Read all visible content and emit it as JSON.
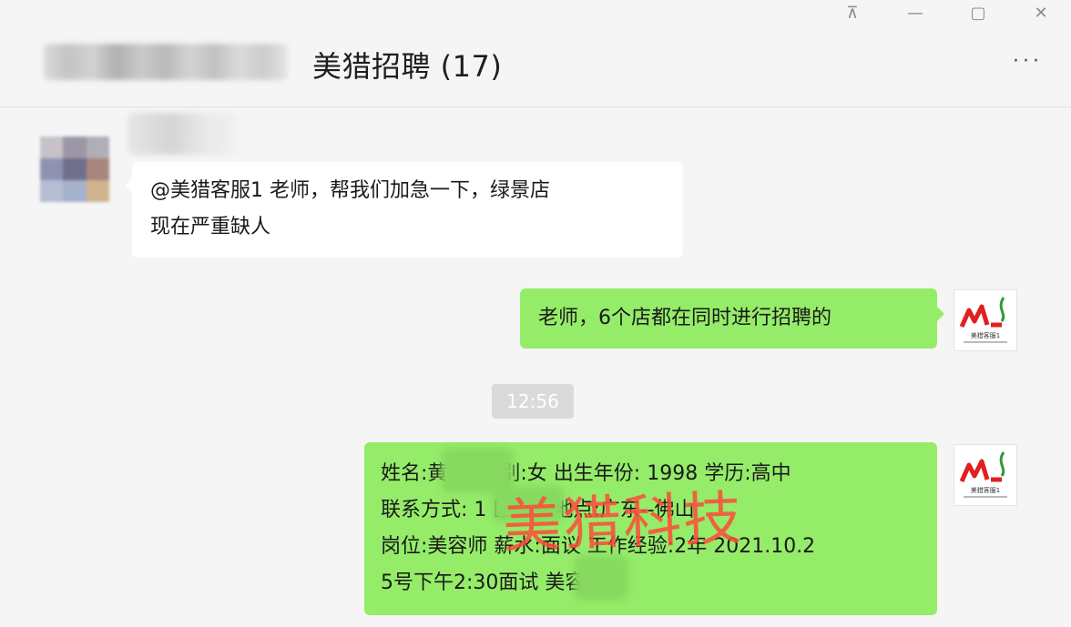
{
  "window": {
    "pin_glyph": "⊼",
    "minimize_glyph": "—",
    "maximize_glyph": "▢",
    "close_glyph": "✕"
  },
  "header": {
    "title": "美猎招聘 (17)",
    "more_glyph": "···"
  },
  "messages": [
    {
      "side": "left",
      "lines": [
        "@美猎客服1 老师，帮我们加急一下，绿景店",
        "现在严重缺人"
      ]
    },
    {
      "side": "right",
      "text": "老师，6个店都在同时进行招聘的"
    },
    {
      "side": "right",
      "lines": [
        "姓名:黄    园 性别:女 出生年份: 1998 学历:高中",
        "联系方式: 1         区工作地点:广东--佛山",
        "岗位:美容师 薪水:面议 工作经验:2年 2021.10.2",
        "5号下午2:30面试       美容师"
      ]
    }
  ],
  "timestamp": "12:56",
  "watermark": "美猎科技",
  "self_avatar": {
    "logo_text": "ML",
    "caption": "美猎客服1"
  },
  "colors": {
    "sent_bubble": "#95ec69",
    "received_bubble": "#ffffff",
    "background": "#f5f5f5",
    "watermark": "#ff4a3a",
    "logo_red": "#e02020",
    "logo_green": "#2e9a3a"
  }
}
